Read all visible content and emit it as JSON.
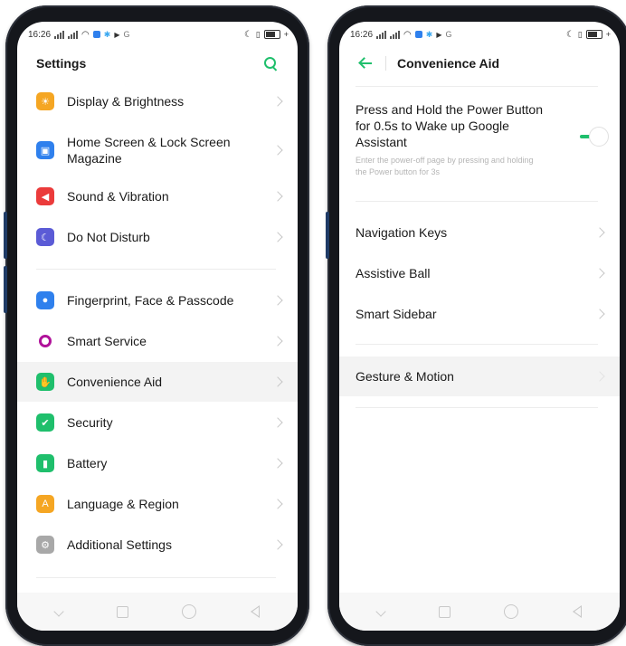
{
  "status_bar": {
    "time": "16:26"
  },
  "left": {
    "title": "Settings",
    "items": [
      {
        "label": "Display & Brightness",
        "icon": "sun-icon",
        "color": "#f5a623",
        "glyph": "☀"
      },
      {
        "label": "Home Screen & Lock Screen Magazine",
        "icon": "image-icon",
        "color": "#2f80ed",
        "glyph": "▣"
      },
      {
        "label": "Sound & Vibration",
        "icon": "speaker-icon",
        "color": "#eb3b3b",
        "glyph": "◀"
      },
      {
        "label": "Do Not Disturb",
        "icon": "moon-icon",
        "color": "#5b5bd6",
        "glyph": "☾"
      },
      {
        "label": "Fingerprint, Face & Passcode",
        "icon": "user-lock-icon",
        "color": "#2f80ed",
        "glyph": "●"
      },
      {
        "label": "Smart Service",
        "icon": "ring-icon",
        "color": "#b0129a",
        "glyph": "○"
      },
      {
        "label": "Convenience Aid",
        "icon": "hand-icon",
        "color": "#1fbf6c",
        "glyph": "✋"
      },
      {
        "label": "Security",
        "icon": "shield-icon",
        "color": "#1fbf6c",
        "glyph": "✔"
      },
      {
        "label": "Battery",
        "icon": "battery-icon",
        "color": "#1fbf6c",
        "glyph": "▮"
      },
      {
        "label": "Language & Region",
        "icon": "letter-a-icon",
        "color": "#f5a623",
        "glyph": "A"
      },
      {
        "label": "Additional Settings",
        "icon": "gear-icon",
        "color": "#a8a8a8",
        "glyph": "⚙"
      }
    ]
  },
  "right": {
    "title": "Convenience Aid",
    "toggle": {
      "title": "Press and Hold the Power Button for 0.5s to Wake up Google Assistant",
      "subtitle": "Enter the power-off page by pressing and holding the Power button for 3s",
      "state": "on"
    },
    "items": [
      {
        "label": "Navigation Keys"
      },
      {
        "label": "Assistive Ball"
      },
      {
        "label": "Smart Sidebar"
      },
      {
        "label": "Gesture & Motion"
      }
    ]
  },
  "colors": {
    "accent": "#1fbf6c"
  }
}
